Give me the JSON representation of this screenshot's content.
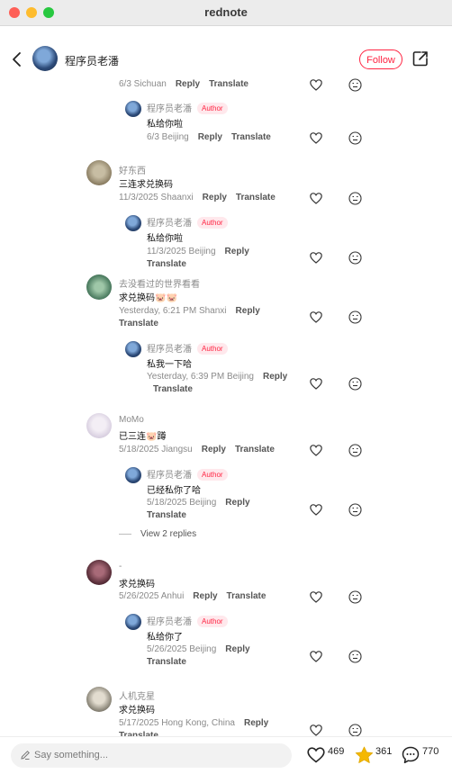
{
  "window": {
    "title": "rednote"
  },
  "header": {
    "author_name": "程序员老潘",
    "follow_label": "Follow"
  },
  "labels": {
    "reply": "Reply",
    "translate": "Translate",
    "author_badge": "Author"
  },
  "comments": [
    {
      "meta": "6/3 Sichuan"
    },
    {
      "name": "程序员老潘",
      "text": "私给你啦",
      "meta": "6/3 Beijing"
    },
    {
      "name": "好东西",
      "text": "三连求兑换码",
      "meta": "11/3/2025 Shaanxi"
    },
    {
      "name": "程序员老潘",
      "text": "私给你啦",
      "meta": "11/3/2025 Beijing"
    },
    {
      "name": "去没看过的世界看看",
      "text": "求兑换码🐷🐷",
      "meta": "Yesterday, 6:21 PM Shanxi"
    },
    {
      "name": "程序员老潘",
      "text": "私我一下哈",
      "meta": "Yesterday, 6:39 PM Beijing"
    },
    {
      "name": "MoMo",
      "text": "已三连🐷蹲",
      "meta": "5/18/2025 Jiangsu"
    },
    {
      "name": "程序员老潘",
      "text": "已经私你了哈",
      "meta": "5/18/2025 Beijing"
    },
    {
      "name": "-",
      "text": "求兑换码",
      "meta": "5/26/2025 Anhui"
    },
    {
      "name": "程序员老潘",
      "text": "私给你了",
      "meta": "5/26/2025 Beijing"
    },
    {
      "name": "人机克星",
      "text": "求兑换码",
      "meta": "5/17/2025 Hong Kong, China"
    }
  ],
  "view_replies": "View 2 replies",
  "bottom": {
    "placeholder": "Say something...",
    "likes": "469",
    "stars": "361",
    "comments": "770"
  }
}
